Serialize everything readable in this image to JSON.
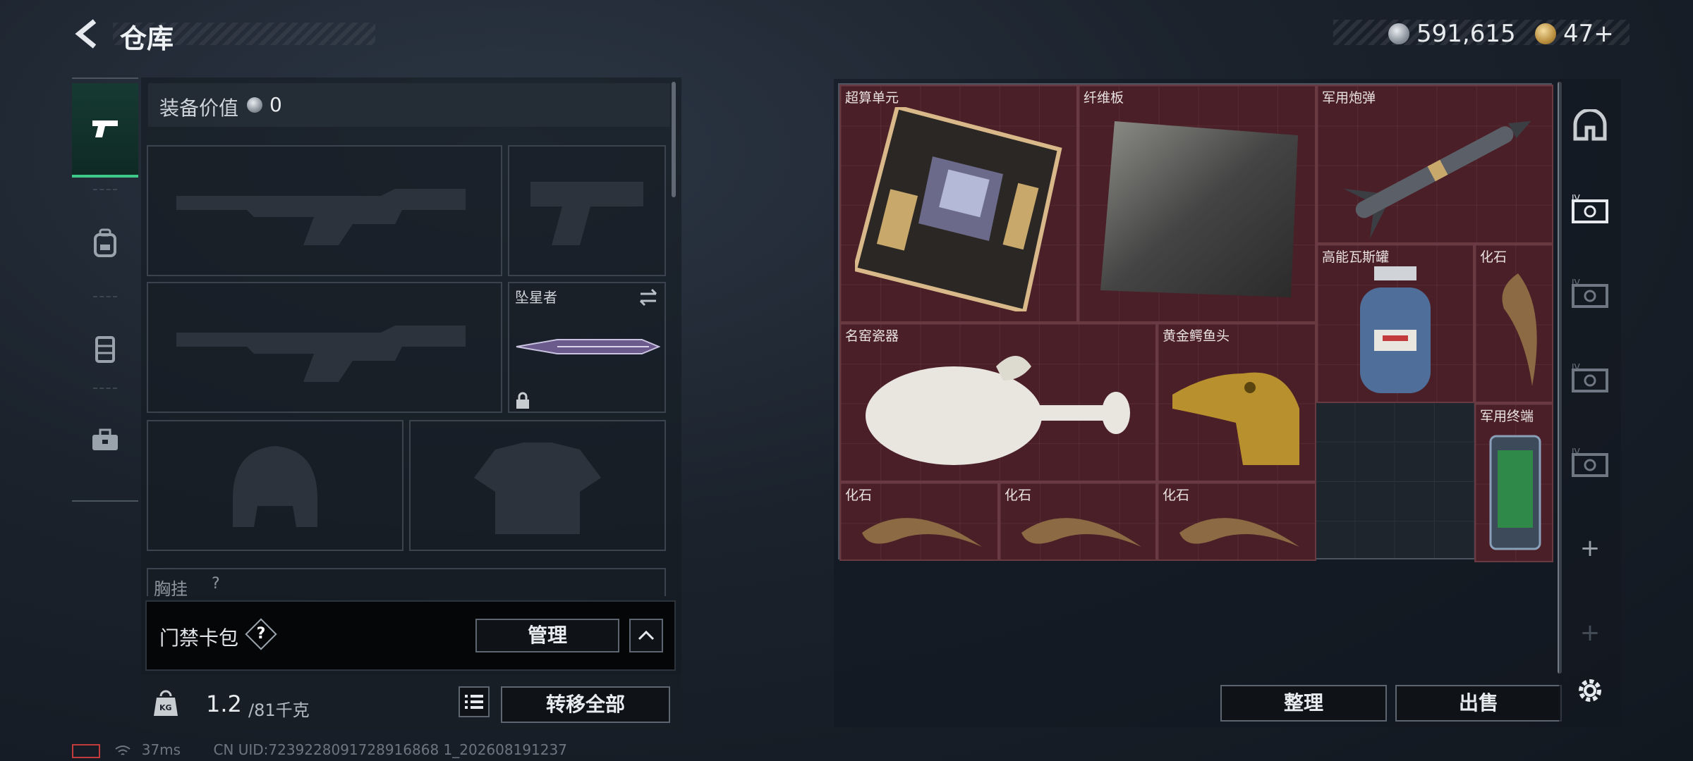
{
  "header": {
    "title": "仓库",
    "silver_amount": "591,615",
    "gold_amount": "47+"
  },
  "nav": {
    "items": [
      "pistol-icon",
      "backpack-icon",
      "vest-icon",
      "toolbox-icon"
    ]
  },
  "loadout": {
    "equipment_value_label": "装备价值",
    "equipment_value": "0",
    "melee_name": "坠星者",
    "next_section_label": "胸挂",
    "next_section_badge": "?"
  },
  "card_pack": {
    "label": "门禁卡包",
    "help": "?",
    "manage_label": "管理"
  },
  "capacity": {
    "badge": "KG",
    "current": "1.2",
    "max": "/81千克",
    "transfer_all": "转移全部"
  },
  "stash": {
    "items": [
      {
        "name": "超算单元"
      },
      {
        "name": "纤维板"
      },
      {
        "name": "军用炮弹"
      },
      {
        "name": "高能瓦斯罐"
      },
      {
        "name": "化石"
      },
      {
        "name": "名窑瓷器"
      },
      {
        "name": "黄金鳄鱼头"
      },
      {
        "name": "军用终端"
      },
      {
        "name": "化石"
      },
      {
        "name": "化石"
      },
      {
        "name": "化石"
      }
    ],
    "organize_label": "整理",
    "sell_label": "出售"
  },
  "side_tabs": {
    "add_symbol": "+"
  },
  "status": {
    "ping": "37ms",
    "uid": "CN UID:7239228091728916868 1_202608191237"
  }
}
